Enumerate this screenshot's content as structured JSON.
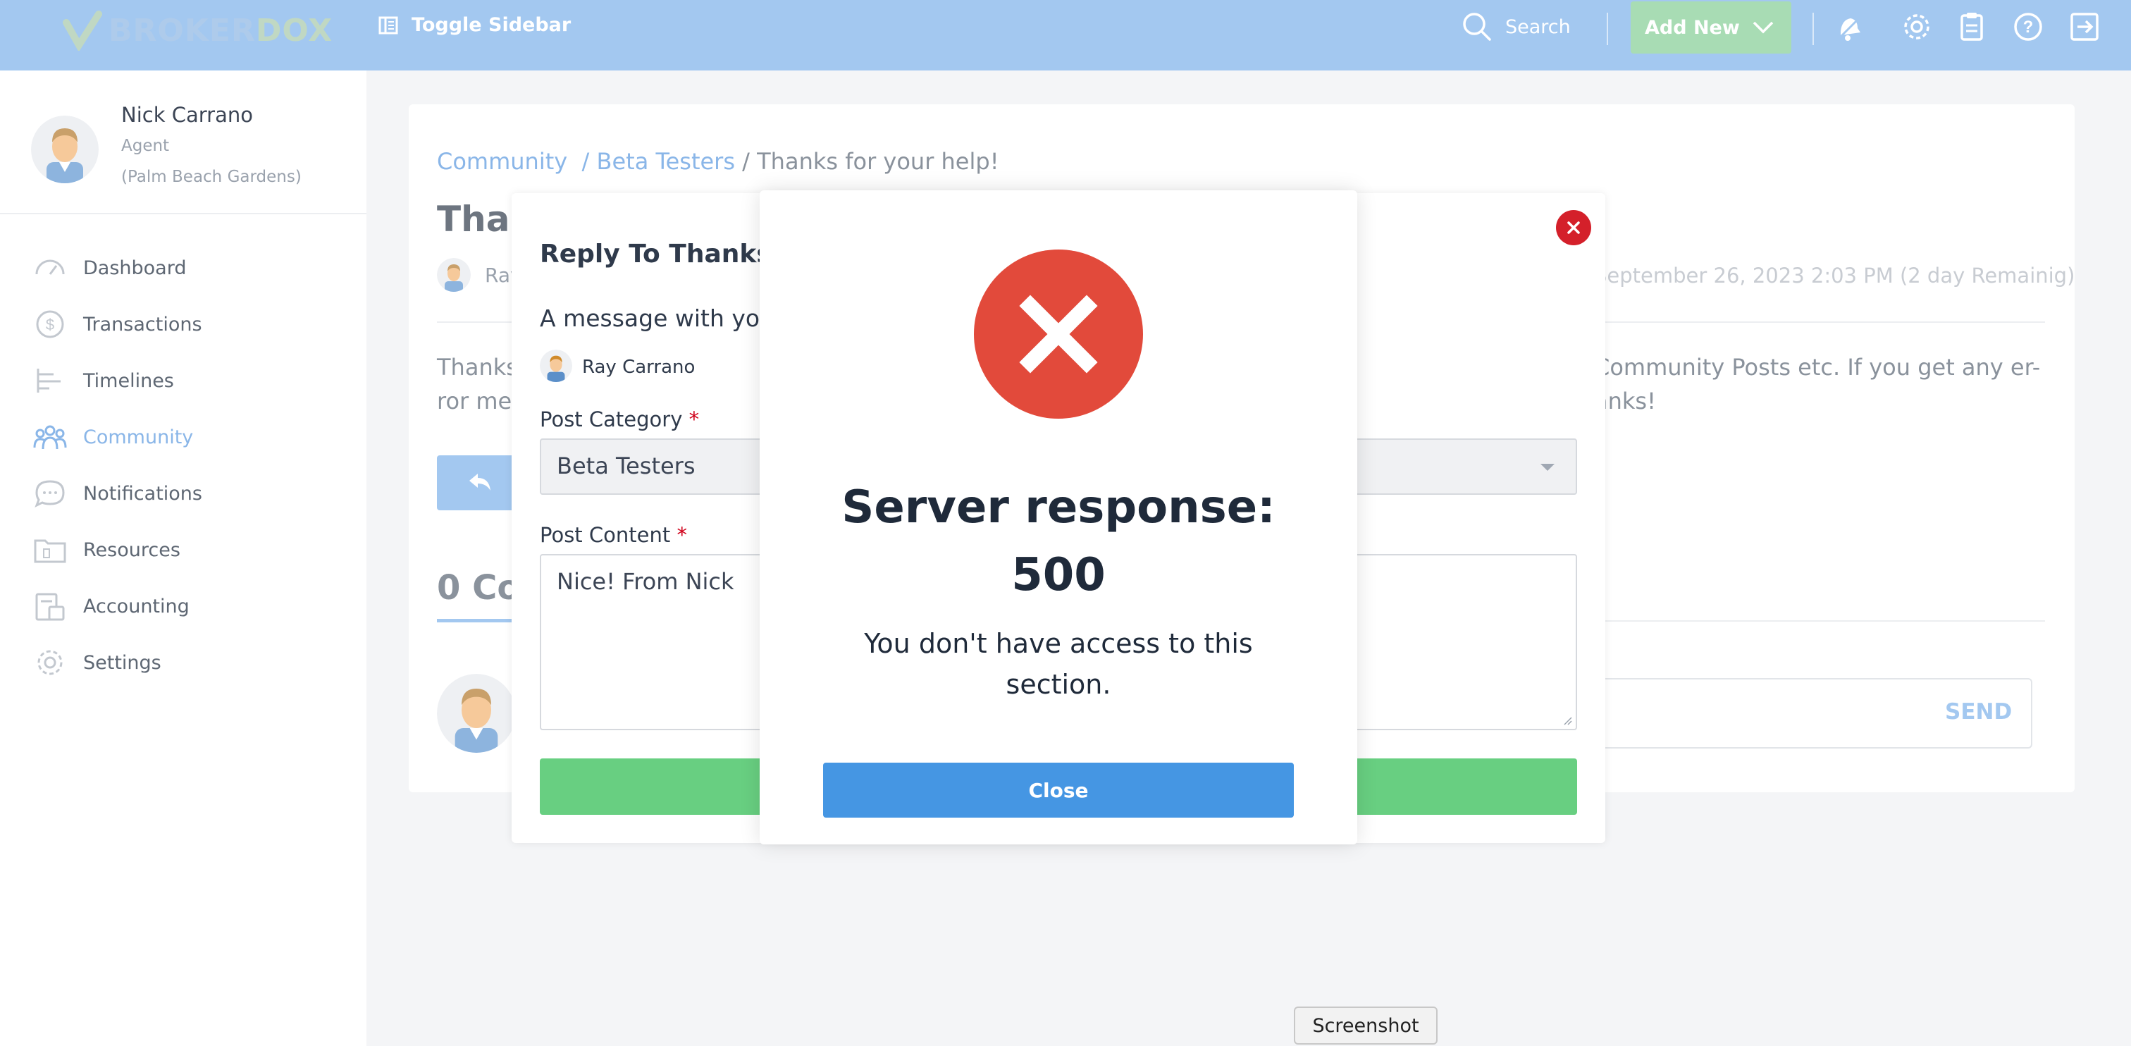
{
  "topbar": {
    "logo_broker": "BROKER",
    "logo_dox": "DOX",
    "toggle_sidebar": "Toggle Sidebar",
    "search": "Search",
    "add_new": "Add New",
    "icons": [
      "bell-icon",
      "gear-icon",
      "clipboard-icon",
      "help-icon",
      "logout-icon"
    ]
  },
  "profile": {
    "name": "Nick Carrano",
    "role": "Agent",
    "location": "(Palm Beach Gardens)"
  },
  "sidebar": {
    "items": [
      {
        "label": "Dashboard",
        "icon": "gauge-icon"
      },
      {
        "label": "Transactions",
        "icon": "dollar-icon"
      },
      {
        "label": "Timelines",
        "icon": "timeline-icon"
      },
      {
        "label": "Community",
        "icon": "people-icon",
        "active": true
      },
      {
        "label": "Notifications",
        "icon": "chat-bubble-icon"
      },
      {
        "label": "Resources",
        "icon": "folder-icon"
      },
      {
        "label": "Accounting",
        "icon": "calculator-icon"
      },
      {
        "label": "Settings",
        "icon": "gear-icon"
      }
    ]
  },
  "breadcrumb": {
    "community": "Community",
    "beta_testers": "/ Beta Testers",
    "current": "/ Thanks for your help!"
  },
  "post": {
    "title_visible": "Thar",
    "author_visible": "Ray",
    "date": "September 26, 2023 2:03 PM (2 day Remainig)",
    "body_line1_left": "Thanks",
    "body_line1_right": "Community Posts etc. If you get any er-",
    "body_line2_left": "ror me",
    "body_line2_right": "anks!",
    "comments_visible": "0 Co",
    "send": "SEND"
  },
  "reply_modal": {
    "title_visible": "Reply To Thanks f",
    "subtitle_visible": "A message with you",
    "user": "Ray Carrano",
    "category_label": "Post Category",
    "category_value": "Beta Testers",
    "content_label": "Post Content",
    "content_value": "Nice! From Nick",
    "required_mark": "*"
  },
  "error_dialog": {
    "title_line1": "Server response:",
    "title_line2": "500",
    "message_line1": "You don't have access to this",
    "message_line2": "section.",
    "close_label": "Close"
  },
  "tooltip": {
    "label": "Screenshot"
  },
  "colors": {
    "topbar": "#a3c8f0",
    "accent_blue": "#4596e3",
    "error_red": "#e24a3b",
    "success_green": "#68cf81"
  }
}
